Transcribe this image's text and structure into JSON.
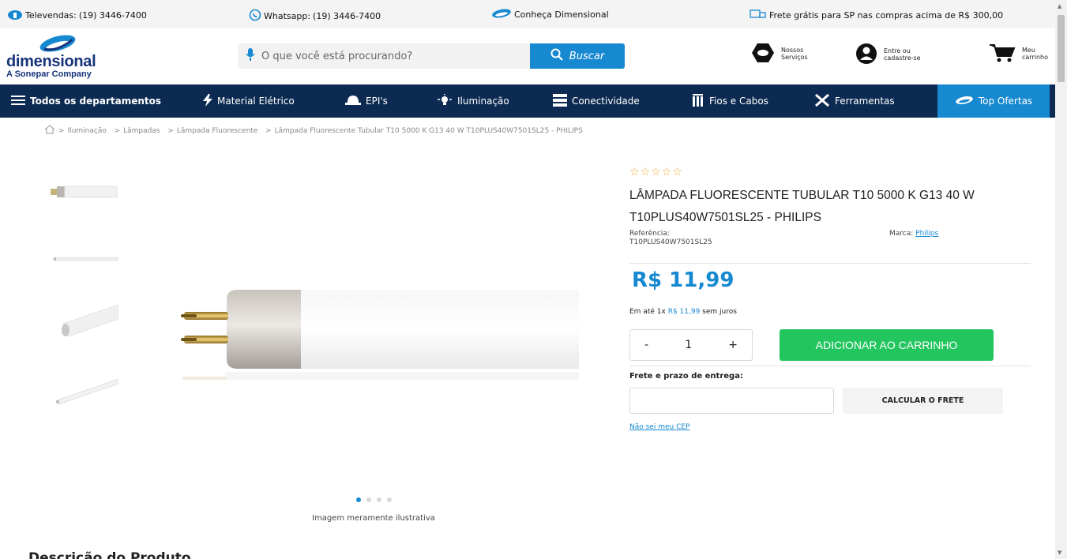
{
  "topbar": {
    "televendas_label": "Televendas:",
    "televendas_number": "(19) 3446-7400",
    "whatsapp_label": "Whatsapp:",
    "whatsapp_number": "(19) 3446-7400",
    "conheca": "Conheça Dimensional",
    "frete": "Frete grátis para SP nas compras acima de R$ 300,00"
  },
  "header": {
    "logo_word": "dimensional",
    "logo_sub": "A Sonepar Company",
    "search_placeholder": "O que você está procurando?",
    "search_button": "Buscar",
    "servicos_line1": "Nossos",
    "servicos_line2": "Serviços",
    "account_line1": "Entre ou",
    "account_line2": "cadastre-se",
    "cart_line1": "Meu",
    "cart_line2": "carrinho"
  },
  "nav": {
    "departamentos": "Todos os departamentos",
    "items": [
      "Material Elétrico",
      "EPI's",
      "Iluminação",
      "Conectividade",
      "Fios e Cabos",
      "Ferramentas"
    ],
    "top_ofertas": "Top Ofertas"
  },
  "breadcrumb": [
    "Iluminação",
    "Lâmpadas",
    "Lâmpada Fluorescente",
    "Lâmpada Fluorescente Tubular T10 5000 K G13 40 W T10PLUS40W7501SL25 - PHILIPS"
  ],
  "gallery": {
    "note": "Imagem meramente ilustrativa",
    "dots_count": 4,
    "active_dot": 0
  },
  "product": {
    "rating_stars": "☆☆☆☆☆",
    "title": "LÂMPADA FLUORESCENTE TUBULAR T10 5000 K G13 40 W T10PLUS40W7501SL25 - PHILIPS",
    "ref_label": "Referência:",
    "ref_value": "T10PLUS40W7501SL25",
    "marca_label": "Marca:",
    "marca_value": "Philips",
    "price": "R$ 11,99",
    "install_prefix": "Em até 1x",
    "install_value": "R$ 11,99",
    "install_suffix": "sem juros",
    "qty_minus": "-",
    "qty_value": "1",
    "qty_plus": "+",
    "add_to_cart": "ADICIONAR AO CARRINHO",
    "frete_label": "Frete e prazo de entrega:",
    "cep_placeholder": "",
    "calc_frete": "CALCULAR O FRETE",
    "cep_link": "Não sei meu CEP"
  },
  "description_title": "Descrição do Produto",
  "colors": {
    "navy": "#0d2b52",
    "accent_blue": "#1689d1",
    "green": "#22c55e",
    "star": "#f2a32a"
  },
  "icons": [
    "phone-headset-icon",
    "whatsapp-icon",
    "dimensional-logo-icon",
    "truck-icon",
    "microphone-icon",
    "search-icon",
    "services-icon",
    "user-icon",
    "cart-icon",
    "menu-icon",
    "bolt-icon",
    "helmet-icon",
    "bulb-icon",
    "network-icon",
    "cables-icon",
    "tools-icon",
    "home-icon"
  ]
}
